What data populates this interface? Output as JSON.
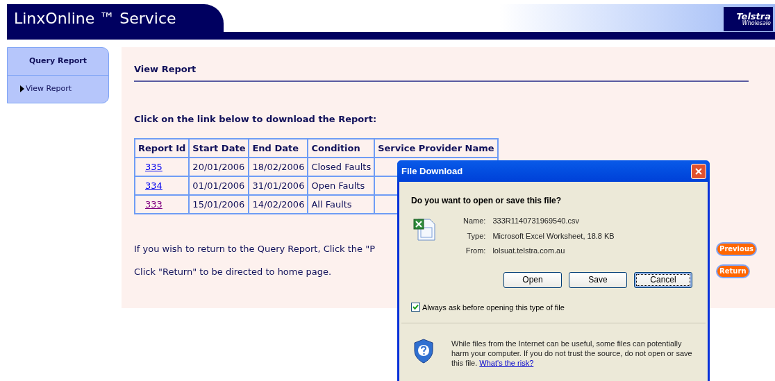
{
  "header": {
    "title": "LinxOnline ™ Service",
    "logo": {
      "name": "Telstra",
      "sub": "Wholesale"
    }
  },
  "sidebar": {
    "heading": "Query Report",
    "items": [
      {
        "label": "View Report",
        "selected": true
      }
    ]
  },
  "content": {
    "title": "View Report",
    "intro": "Click on the link below to download the Report:",
    "table": {
      "columns": [
        "Report Id",
        "Start Date",
        "End Date",
        "Condition",
        "Service Provider Name"
      ],
      "rows": [
        {
          "id": "335",
          "visited": false,
          "start": "20/01/2006",
          "end": "18/02/2006",
          "condition": "Closed Faults"
        },
        {
          "id": "334",
          "visited": false,
          "start": "01/01/2006",
          "end": "31/01/2006",
          "condition": "Open Faults"
        },
        {
          "id": "333",
          "visited": true,
          "start": "15/01/2006",
          "end": "14/02/2006",
          "condition": "All Faults"
        }
      ]
    },
    "notes": [
      "If you wish to return to the Query Report, Click the \"P",
      "Click \"Return\" to be directed to home page."
    ],
    "buttons": [
      "Previous",
      "Return"
    ]
  },
  "dialog": {
    "title": "File Download",
    "question": "Do you want to open or save this file?",
    "fields": [
      {
        "label": "Name:",
        "value": "333R1140731969540.csv"
      },
      {
        "label": "Type:",
        "value": "Microsoft Excel Worksheet, 18.8 KB"
      },
      {
        "label": "From:",
        "value": "lolsuat.telstra.com.au"
      }
    ],
    "buttons": [
      {
        "label": "Open",
        "focused": false
      },
      {
        "label": "Save",
        "focused": false
      },
      {
        "label": "Cancel",
        "focused": true
      }
    ],
    "checkbox": {
      "label": "Always ask before opening this type of file",
      "checked": true
    },
    "warning": "While files from the Internet can be useful, some files can potentially harm your computer. If you do not trust the source, do not open or save this file.",
    "risk_link": "What's the risk?"
  }
}
